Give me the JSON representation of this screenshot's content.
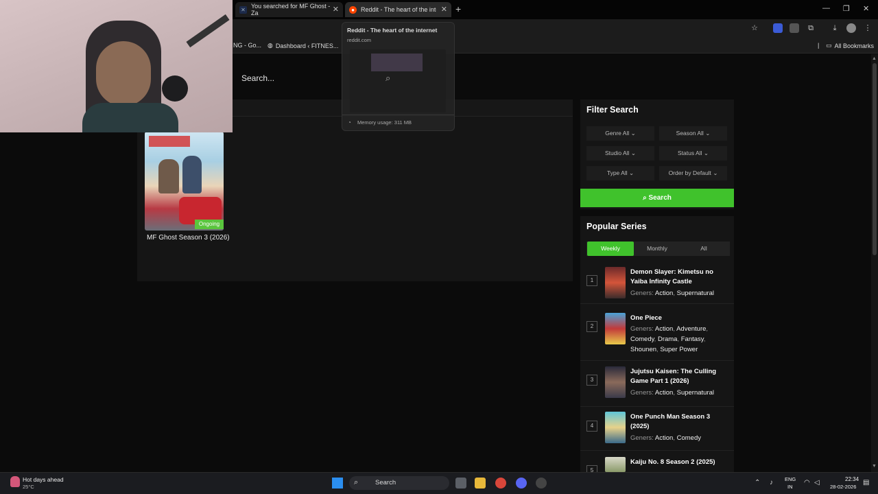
{
  "browser": {
    "tabs": [
      {
        "title": "You searched for MF Ghost - Za"
      },
      {
        "title": "Reddit - The heart of the intern"
      }
    ],
    "bookmarks": [
      {
        "label": "NG - Go..."
      },
      {
        "label": "Dashboard ‹ FITNES..."
      }
    ],
    "all_bookmarks_label": "All Bookmarks",
    "hover_card": {
      "title": "Reddit - The heart of the internet",
      "url": "reddit.com",
      "memory": "Memory usage: 311 MB"
    }
  },
  "site": {
    "search_placeholder": "Search...",
    "result": {
      "title": "MF Ghost Season 3 (2026)",
      "badge": "Ongoing"
    },
    "filter": {
      "title": "Filter Search",
      "buttons": [
        "Genre All",
        "Season All",
        "Studio All",
        "Status All",
        "Type All",
        "Order by Default"
      ],
      "search_label": "Search"
    },
    "popular": {
      "title": "Popular Series",
      "tabs": [
        "Weekly",
        "Monthly",
        "All"
      ],
      "genres_label": "Geners:",
      "items": [
        {
          "rank": "1",
          "title": "Demon Slayer: Kimetsu no Yaiba Infinity Castle",
          "genres": [
            "Action",
            "Supernatural"
          ]
        },
        {
          "rank": "2",
          "title": "One Piece",
          "genres": [
            "Action",
            "Adventure",
            "Comedy",
            "Drama",
            "Fantasy",
            "Shounen",
            "Super Power"
          ]
        },
        {
          "rank": "3",
          "title": "Jujutsu Kaisen: The Culling Game Part 1 (2026)",
          "genres": [
            "Action",
            "Supernatural"
          ]
        },
        {
          "rank": "4",
          "title": "One Punch Man Season 3 (2025)",
          "genres": [
            "Action",
            "Comedy"
          ]
        },
        {
          "rank": "5",
          "title": "Kaiju No. 8 Season 2 (2025)",
          "genres": []
        }
      ]
    }
  },
  "taskbar": {
    "weather_title": "Hot days ahead",
    "weather_temp": "25°C",
    "search_label": "Search",
    "lang_1": "ENG",
    "lang_2": "IN",
    "time": "22:34",
    "date": "28-02-2026"
  },
  "colors": {
    "accent": "#40c22c",
    "badge": "#5ac53d"
  }
}
